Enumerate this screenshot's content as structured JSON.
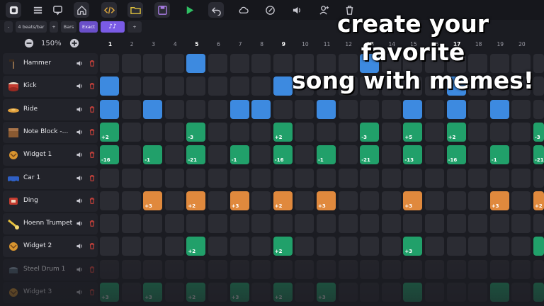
{
  "toolbar": {
    "icons": [
      "app-logo-icon",
      "menu-icon",
      "comment-icon",
      "home-icon",
      "code-icon",
      "folder-icon",
      "save-icon",
      "play-icon",
      "undo-icon",
      "cloud-icon",
      "edit-icon",
      "volume-icon",
      "add-user-icon",
      "trash-icon"
    ]
  },
  "subbar": {
    "minus": "-",
    "beats_label": "4 beats/bar",
    "plus": "+",
    "bars_label": "Bars",
    "exact_label": "Exact",
    "note_label": "♪♪",
    "add_label": "+"
  },
  "zoom": {
    "value": "150%"
  },
  "overlay_text": {
    "line1": "create your favorite",
    "line2": "song with memes!"
  },
  "colors": {
    "blue": "#3d8ae0",
    "green": "#21a06a",
    "orange": "#e0893d",
    "accent": "#7a5be6"
  },
  "columns": [
    "1",
    "2",
    "3",
    "4",
    "5",
    "6",
    "7",
    "8",
    "9",
    "10",
    "11",
    "12",
    "13",
    "14",
    "15",
    "16",
    "17",
    "18",
    "19",
    "20"
  ],
  "tracks": [
    {
      "name": "Hammer",
      "icon": "hammer-icon",
      "color": "blue",
      "cells": {
        "5": "",
        "13": ""
      }
    },
    {
      "name": "Kick",
      "icon": "drum-icon",
      "color": "blue",
      "cells": {
        "1": "",
        "9": "",
        "17": ""
      }
    },
    {
      "name": "Ride",
      "icon": "cymbal-icon",
      "color": "blue",
      "cells": {
        "1": "",
        "3": "",
        "7": "",
        "8": "",
        "11": "",
        "15": "",
        "17": "",
        "19": ""
      }
    },
    {
      "name": "Note Block -...",
      "icon": "note-block-icon",
      "color": "green",
      "cells": {
        "1": "+2",
        "5": "-3",
        "9": "+2",
        "13": "-3",
        "15": "+5",
        "17": "+2",
        "21": "-3"
      }
    },
    {
      "name": "Widget 1",
      "icon": "widget-icon",
      "color": "green",
      "cells": {
        "1": "-16",
        "3": "-1",
        "5": "-21",
        "7": "-1",
        "9": "-16",
        "11": "-1",
        "13": "-21",
        "15": "-13",
        "17": "-16",
        "19": "-1",
        "21": "-21"
      }
    },
    {
      "name": "Car 1",
      "icon": "car-icon",
      "color": "green",
      "cells": {}
    },
    {
      "name": "Ding",
      "icon": "ding-icon",
      "color": "orange",
      "cells": {
        "3": "+3",
        "5": "+2",
        "7": "+3",
        "9": "+2",
        "11": "+3",
        "15": "+3",
        "19": "+3",
        "21": "+2"
      }
    },
    {
      "name": "Hoenn Trumpet",
      "icon": "trumpet-icon",
      "color": "green",
      "cells": {}
    },
    {
      "name": "Widget 2",
      "icon": "widget-icon",
      "color": "green",
      "cells": {
        "5": "+2",
        "9": "+2",
        "15": "+3",
        "21": ""
      }
    },
    {
      "name": "Steel Drum 1",
      "icon": "steel-drum-icon",
      "color": "green",
      "cells": {}
    },
    {
      "name": "Widget 3",
      "icon": "widget-icon",
      "color": "green",
      "cells": {
        "1": "+3",
        "3": "+3",
        "5": "+2",
        "7": "+3",
        "9": "+2",
        "11": "+3",
        "15": "",
        "19": "",
        "21": ""
      }
    }
  ]
}
